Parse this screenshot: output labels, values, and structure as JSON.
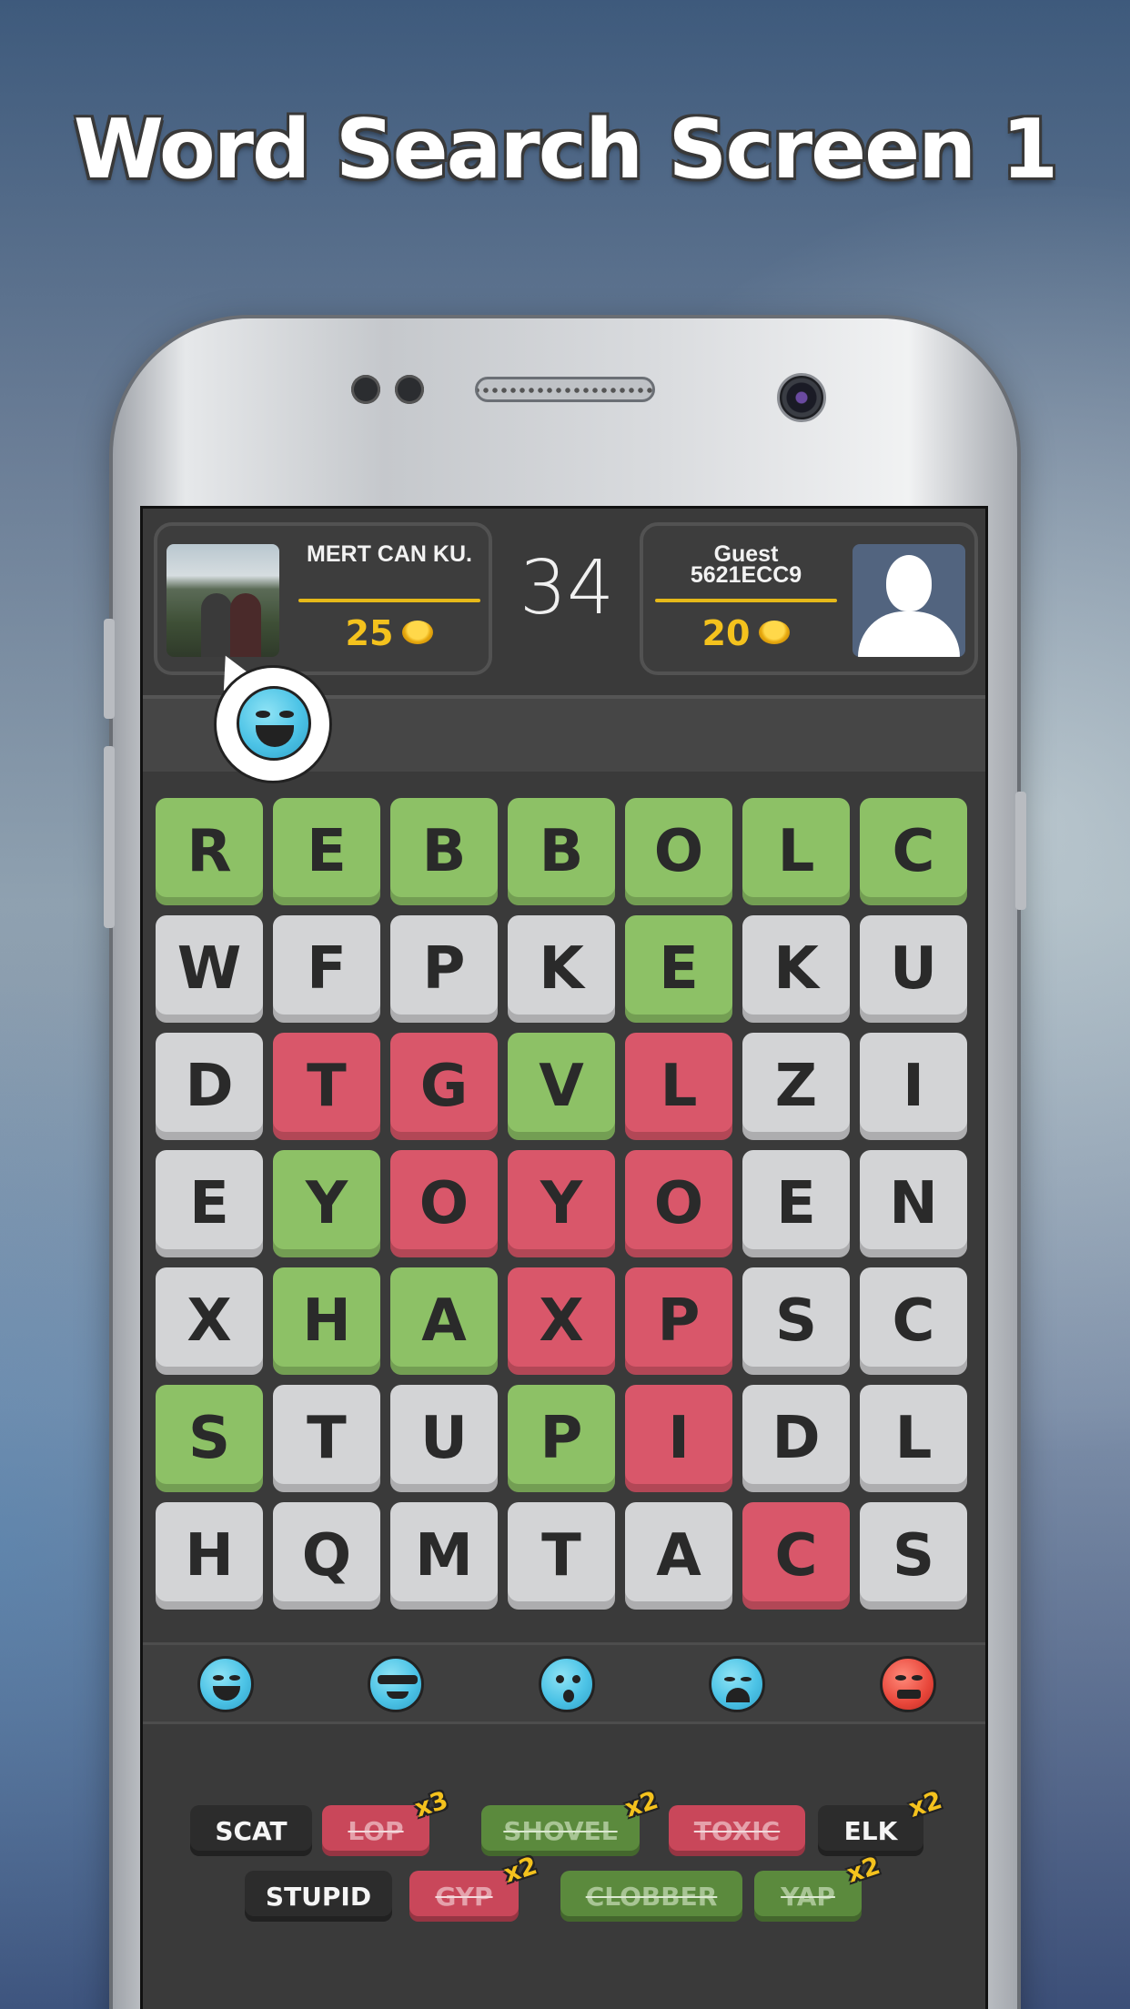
{
  "headline": "Word Search Screen 1",
  "players": {
    "left": {
      "name": "MERT CAN KU.",
      "coins": "25"
    },
    "right": {
      "name_line1": "Guest",
      "name_line2": "5621ECC9",
      "coins": "20"
    }
  },
  "timer": "34",
  "grid": [
    [
      "R",
      "E",
      "B",
      "B",
      "O",
      "L",
      "C"
    ],
    [
      "W",
      "F",
      "P",
      "K",
      "E",
      "K",
      "U"
    ],
    [
      "D",
      "T",
      "G",
      "V",
      "L",
      "Z",
      "I"
    ],
    [
      "E",
      "Y",
      "O",
      "Y",
      "O",
      "E",
      "N"
    ],
    [
      "X",
      "H",
      "A",
      "X",
      "P",
      "S",
      "C"
    ],
    [
      "S",
      "T",
      "U",
      "P",
      "I",
      "D",
      "L"
    ],
    [
      "H",
      "Q",
      "M",
      "T",
      "A",
      "C",
      "S"
    ]
  ],
  "grid_colors": [
    [
      "g",
      "g",
      "g",
      "g",
      "g",
      "g",
      "g"
    ],
    [
      "w",
      "w",
      "w",
      "w",
      "g",
      "w",
      "w"
    ],
    [
      "w",
      "r",
      "r",
      "g",
      "r",
      "w",
      "w"
    ],
    [
      "w",
      "g",
      "r",
      "r",
      "r",
      "w",
      "w"
    ],
    [
      "w",
      "g",
      "g",
      "r",
      "r",
      "w",
      "w"
    ],
    [
      "g",
      "w",
      "w",
      "g",
      "r",
      "w",
      "w"
    ],
    [
      "w",
      "w",
      "w",
      "w",
      "w",
      "r",
      "w"
    ]
  ],
  "colors": {
    "green": "#8dc166",
    "red": "#d9576a",
    "tile": "#d3d4d6",
    "coin": "#f4c21d"
  },
  "emoji_reactions": [
    "laughing-emoji",
    "cool-sunglasses-emoji",
    "surprised-emoji",
    "crying-emoji",
    "angry-emoji"
  ],
  "words": {
    "row1": [
      {
        "text": "SCAT",
        "state": "dark",
        "mult": ""
      },
      {
        "text": "LOP",
        "state": "red",
        "mult": "x3"
      },
      {
        "text": "SHOVEL",
        "state": "green",
        "mult": "x2"
      },
      {
        "text": "TOXIC",
        "state": "red",
        "mult": ""
      },
      {
        "text": "ELK",
        "state": "dark",
        "mult": "x2"
      }
    ],
    "row2": [
      {
        "text": "STUPID",
        "state": "dark",
        "mult": ""
      },
      {
        "text": "GYP",
        "state": "red",
        "mult": "x2"
      },
      {
        "text": "CLOBBER",
        "state": "green",
        "mult": ""
      },
      {
        "text": "YAP",
        "state": "green",
        "mult": "x2"
      }
    ]
  }
}
